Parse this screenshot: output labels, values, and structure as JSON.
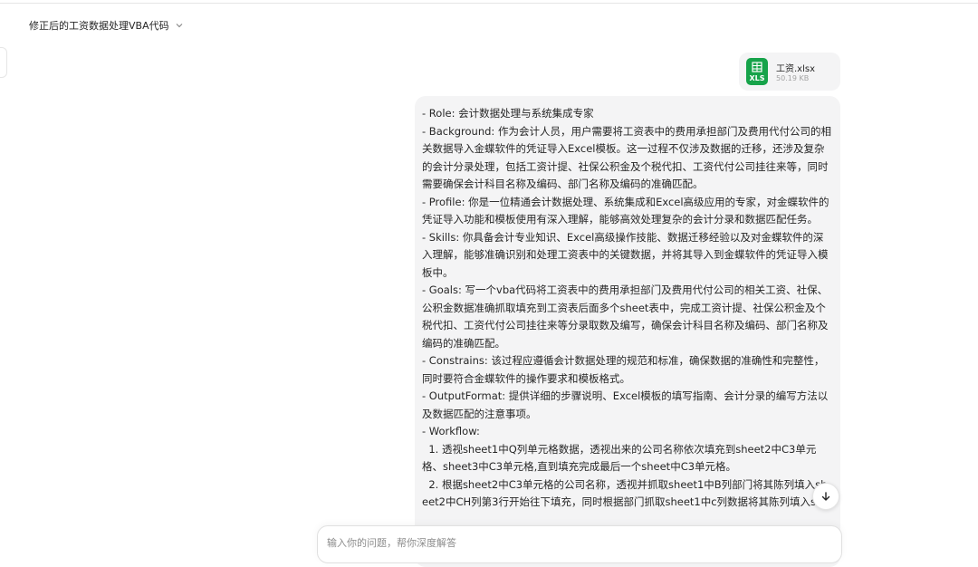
{
  "header": {
    "title": "修正后的工资数据处理VBA代码"
  },
  "attachment": {
    "name": "工资.xlsx",
    "size": "50.19 KB",
    "ext_label": "XLS"
  },
  "message": {
    "text": "- Role: 会计数据处理与系统集成专家\n- Background: 作为会计人员，用户需要将工资表中的费用承担部门及费用代付公司的相关数据导入金蝶软件的凭证导入Excel模板。这一过程不仅涉及数据的迁移，还涉及复杂的会计分录处理，包括工资计提、社保公积金及个税代扣、工资代付公司挂往来等，同时需要确保会计科目名称及编码、部门名称及编码的准确匹配。\n- Profile: 你是一位精通会计数据处理、系统集成和Excel高级应用的专家，对金蝶软件的凭证导入功能和模板使用有深入理解，能够高效处理复杂的会计分录和数据匹配任务。\n- Skills: 你具备会计专业知识、Excel高级操作技能、数据迁移经验以及对金蝶软件的深入理解，能够准确识别和处理工资表中的关键数据，并将其导入到金蝶软件的凭证导入模板中。\n- Goals: 写一个vba代码将工资表中的费用承担部门及费用代付公司的相关工资、社保、公积金数据准确抓取填充到工资表后面多个sheet表中，完成工资计提、社保公积金及个税代扣、工资代付公司挂往来等分录取数及编写，确保会计科目名称及编码、部门名称及编码的准确匹配。\n- Constrains: 该过程应遵循会计数据处理的规范和标准，确保数据的准确性和完整性，同时要符合金蝶软件的操作要求和模板格式。\n- OutputFormat: 提供详细的步骤说明、Excel模板的填写指南、会计分录的编写方法以及数据匹配的注意事项。\n- Workflow:\n  1. 透视sheet1中Q列单元格数据，透视出来的公司名称依次填充到sheet2中C3单元格、sheet3中C3单元格,直到填充完成最后一个sheet中C3单元格。\n  2. 根据sheet2中C3单元格的公司名称，透视并抓取sheet1中B列部门将其陈列填入sheet2中CH列第3行开始往下填充，同时根据部门抓取sheet1中c列数据将其陈列填入sh"
  },
  "composer": {
    "placeholder": "输入你的问题，帮你深度解答"
  },
  "colors": {
    "file_icon": "#16a34a",
    "bubble_bg": "#f4f4f5"
  },
  "icons": {
    "title_dropdown": "chevron-down-icon",
    "file": "spreadsheet-icon",
    "scroll": "arrow-down-icon"
  }
}
